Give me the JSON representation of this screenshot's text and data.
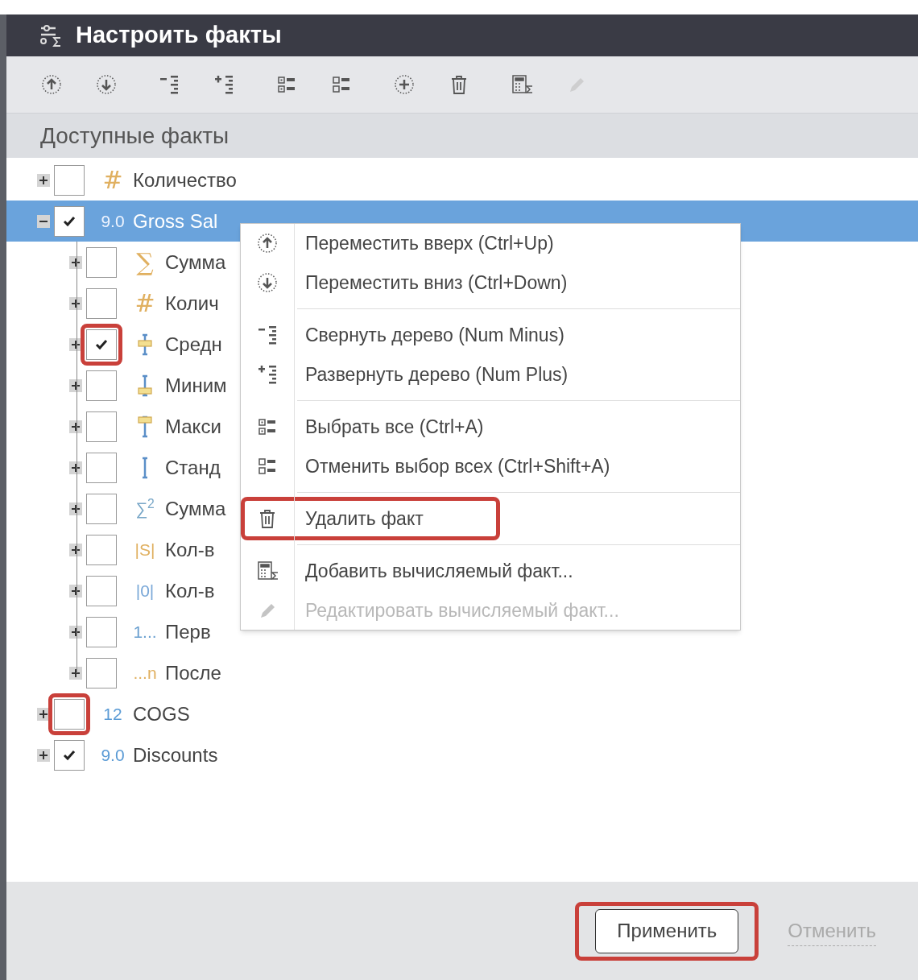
{
  "window": {
    "title": "Настроить факты"
  },
  "toolbar": [
    {
      "kind": "up",
      "disabled": false
    },
    {
      "kind": "down",
      "disabled": false
    },
    {
      "kind": "collapse",
      "disabled": false
    },
    {
      "kind": "expand",
      "disabled": false
    },
    {
      "kind": "select_all",
      "disabled": false
    },
    {
      "kind": "deselect_all",
      "disabled": false
    },
    {
      "kind": "add",
      "disabled": false
    },
    {
      "kind": "delete",
      "disabled": false
    },
    {
      "kind": "calc_add",
      "disabled": false
    },
    {
      "kind": "edit",
      "disabled": true
    }
  ],
  "section_title": "Доступные факты",
  "tree": [
    {
      "kind": "count",
      "glyph": "#",
      "label": "Количество",
      "expanded": false,
      "checked": false,
      "selected": false,
      "highlighted": false
    },
    {
      "kind": "decimal",
      "glyph": "9.0",
      "label": "Gross Sal",
      "expanded": true,
      "checked": true,
      "selected": true,
      "highlighted": false,
      "children": [
        {
          "kind": "sum",
          "glyph": "∑",
          "label": "Сумма",
          "expanded": false,
          "checked": false,
          "selected": false,
          "highlighted": false
        },
        {
          "kind": "count",
          "glyph": "#",
          "label": "Колич",
          "expanded": false,
          "checked": false,
          "selected": false,
          "highlighted": false
        },
        {
          "kind": "avg",
          "label": "Средн",
          "expanded": false,
          "checked": true,
          "selected": false,
          "highlighted": true
        },
        {
          "kind": "min",
          "label": "Миним",
          "expanded": false,
          "checked": false,
          "selected": false,
          "highlighted": false
        },
        {
          "kind": "max",
          "label": "Макси",
          "expanded": false,
          "checked": false,
          "selected": false,
          "highlighted": false
        },
        {
          "kind": "stdev",
          "label": "Станд",
          "expanded": false,
          "checked": false,
          "selected": false,
          "highlighted": false
        },
        {
          "kind": "sumsq",
          "glyph": "∑$^{2}$",
          "label": "Сумма",
          "expanded": false,
          "checked": false,
          "selected": false,
          "highlighted": false
        },
        {
          "kind": "distinct",
          "glyph": "|S|",
          "label": "Кол-в",
          "expanded": false,
          "checked": false,
          "selected": false,
          "highlighted": false
        },
        {
          "kind": "zero",
          "glyph": "|0|",
          "label": "Кол-в",
          "expanded": false,
          "checked": false,
          "selected": false,
          "highlighted": false
        },
        {
          "kind": "first",
          "glyph": "1...",
          "label": "Перв",
          "expanded": false,
          "checked": false,
          "selected": false,
          "highlighted": false
        },
        {
          "kind": "last",
          "glyph": "...n",
          "label": "После",
          "expanded": false,
          "checked": false,
          "selected": false,
          "highlighted": false
        }
      ]
    },
    {
      "kind": "integer",
      "glyph": "12",
      "label": "COGS",
      "expanded": false,
      "checked": false,
      "selected": false,
      "highlighted": true
    },
    {
      "kind": "decimal",
      "glyph": "9.0",
      "label": "Discounts",
      "expanded": false,
      "checked": true,
      "selected": false,
      "highlighted": false
    }
  ],
  "context_menu": [
    [
      {
        "kind": "up",
        "label": "Переместить вверх (Ctrl+Up)",
        "disabled": false,
        "highlighted": false
      },
      {
        "kind": "down",
        "label": "Переместить вниз (Ctrl+Down)",
        "disabled": false,
        "highlighted": false
      }
    ],
    [
      {
        "kind": "collapse",
        "label": "Свернуть дерево (Num Minus)",
        "disabled": false,
        "highlighted": false
      },
      {
        "kind": "expand",
        "label": "Развернуть дерево (Num Plus)",
        "disabled": false,
        "highlighted": false
      }
    ],
    [
      {
        "kind": "select_all",
        "label": "Выбрать все (Ctrl+A)",
        "disabled": false,
        "highlighted": false
      },
      {
        "kind": "deselect_all",
        "label": "Отменить выбор всех (Ctrl+Shift+A)",
        "disabled": false,
        "highlighted": false
      }
    ],
    [
      {
        "kind": "delete",
        "label": "Удалить факт",
        "disabled": false,
        "highlighted": true
      }
    ],
    [
      {
        "kind": "calc_add",
        "label": "Добавить вычисляемый факт...",
        "disabled": false,
        "highlighted": false
      },
      {
        "kind": "edit",
        "label": "Редактировать вычисляемый факт...",
        "disabled": true,
        "highlighted": false
      }
    ]
  ],
  "footer": {
    "apply": {
      "label": "Применить",
      "highlighted": true
    },
    "cancel": {
      "label": "Отменить",
      "disabled": true
    }
  }
}
